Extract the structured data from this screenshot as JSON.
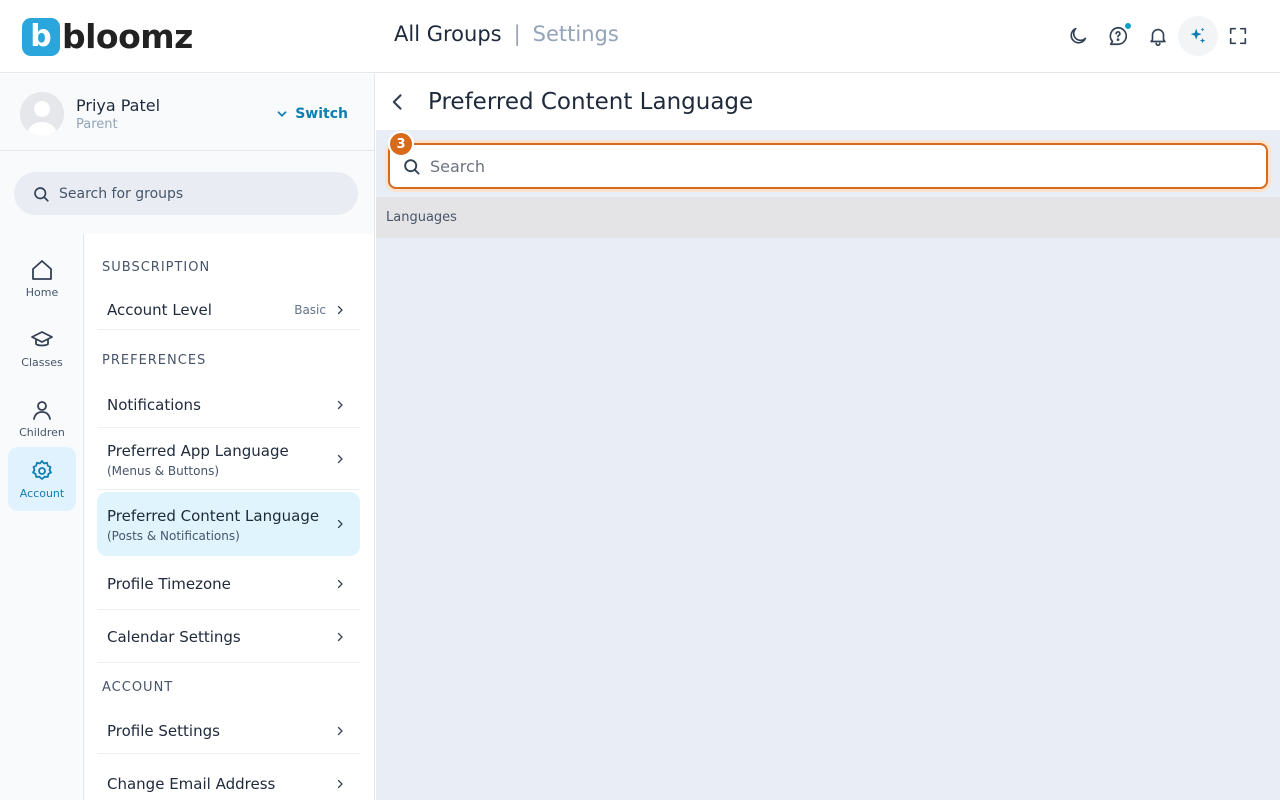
{
  "header": {
    "logo_letter": "b",
    "logo_text": "bloomz",
    "breadcrumb_main": "All Groups",
    "breadcrumb_sep": "|",
    "breadcrumb_sub": "Settings",
    "icons": [
      "moon-icon",
      "help-chat-icon",
      "bell-icon",
      "ai-sparkle-icon",
      "fullscreen-icon"
    ]
  },
  "profile": {
    "name": "Priya Patel",
    "role": "Parent",
    "switch_label": "Switch"
  },
  "group_search": {
    "placeholder": "Search for groups"
  },
  "rail": {
    "items": [
      {
        "label": "Home",
        "icon": "home-icon"
      },
      {
        "label": "Classes",
        "icon": "graduation-cap-icon"
      },
      {
        "label": "Children",
        "icon": "person-icon"
      },
      {
        "label": "Account",
        "icon": "gear-icon",
        "active": true
      }
    ]
  },
  "menu": {
    "subscription_heading": "SUBSCRIPTION",
    "account_level": {
      "label": "Account Level",
      "badge": "Basic"
    },
    "preferences_heading": "PREFERENCES",
    "notifications": {
      "label": "Notifications"
    },
    "app_language": {
      "label": "Preferred App Language",
      "sub": "(Menus & Buttons)"
    },
    "content_language": {
      "label": "Preferred Content Language",
      "sub": "(Posts & Notifications)"
    },
    "timezone": {
      "label": "Profile Timezone"
    },
    "calendar": {
      "label": "Calendar Settings"
    },
    "account_heading": "ACCOUNT",
    "profile_settings": {
      "label": "Profile Settings"
    },
    "change_email": {
      "label": "Change Email Address"
    }
  },
  "main": {
    "title": "Preferred Content Language",
    "search_placeholder": "Search",
    "step_badge": "3",
    "languages_header": "Languages"
  },
  "colors": {
    "accent": "#0e7fb0",
    "brand": "#2aa6dd",
    "highlight": "#d86a1b"
  }
}
